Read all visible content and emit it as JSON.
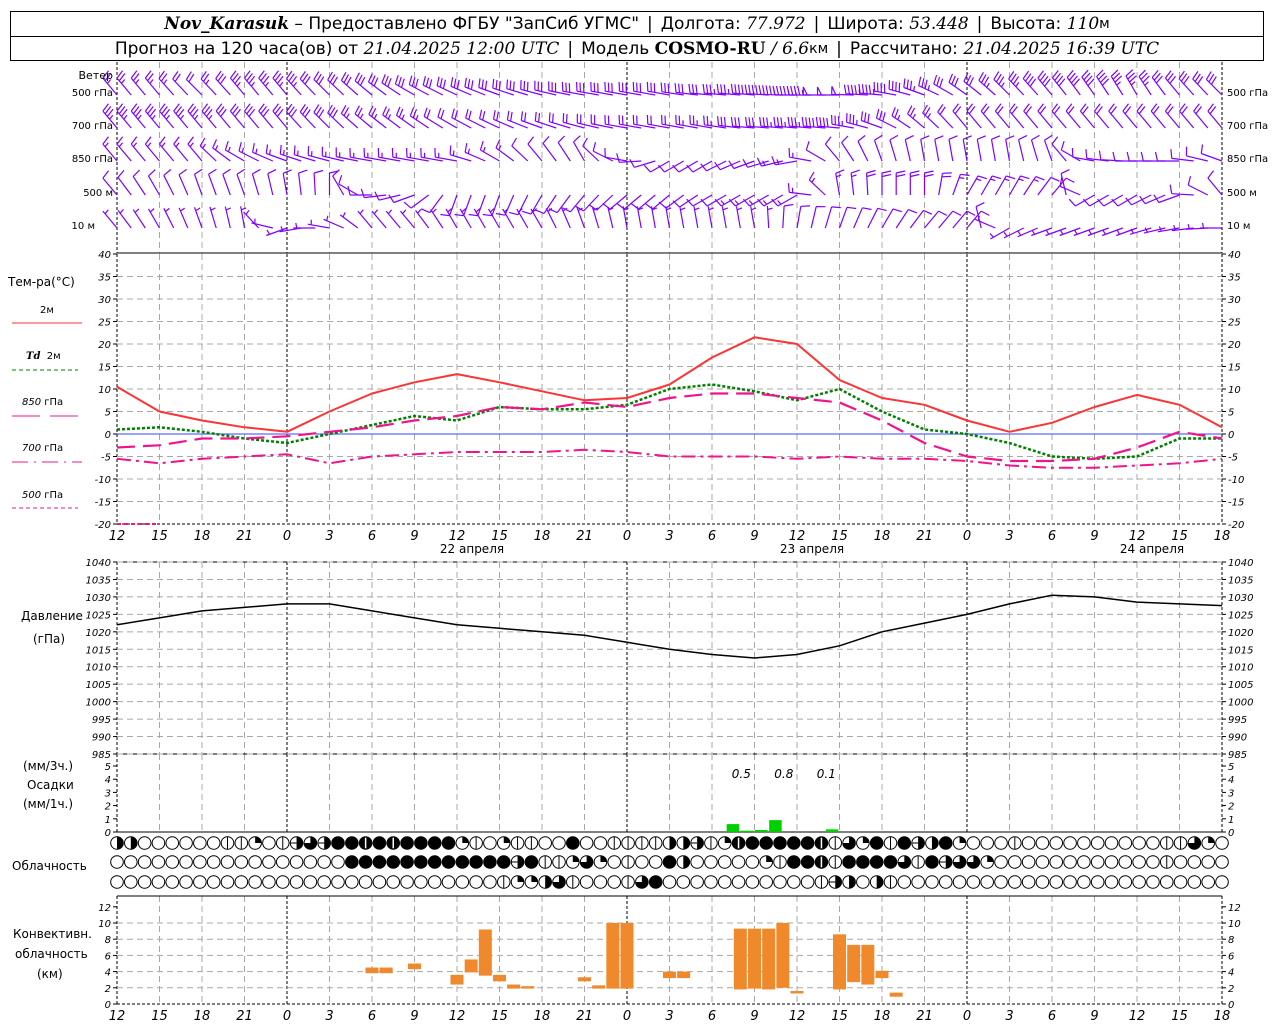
{
  "header": {
    "station": "Nov_Karasuk",
    "provider": "– Предоставлено ФГБУ \"ЗапСиб УГМС\"",
    "lon_label": "Долгота:",
    "lon": "77.972",
    "lat_label": "Широта:",
    "lat": "53.448",
    "alt_label": "Высота:",
    "alt": "110",
    "alt_unit": "м",
    "forecast_label": "Прогноз на 120 часа(ов) от",
    "forecast_time": "21.04.2025 12:00 UTC",
    "model_label": "Модель",
    "model": "COSMO-RU",
    "resolution": "/ 6.6",
    "resolution_unit": "км",
    "calc_label": "Рассчитано:",
    "calc_time": "21.04.2025 16:39 UTC"
  },
  "labels": {
    "wind": "Ветер",
    "lev500hpa": "500 гПа",
    "lev700hpa": "700 гПа",
    "lev850hpa": "850 гПа",
    "lev500m": "500 м",
    "lev10m": "10  м",
    "temp_title": "Тем-ра(°С)",
    "t2m": "2м",
    "td": "Td",
    "td2m": "2м",
    "t850": "850",
    "t700": "700",
    "t500": "500",
    "hpa": "гПа",
    "pressure": "Давление",
    "pressure_unit": "(гПа)",
    "precip_3h": "(мм/3ч.)",
    "precip": "Осадки",
    "precip_1h": "(мм/1ч.)",
    "cloudiness": "Облачность",
    "conv1": "Конвективн.",
    "conv2": "облачность",
    "conv3": "(км)"
  },
  "colors": {
    "wind": "#8000ff",
    "t2m": "#ff3333",
    "td2m": "#008000",
    "upper": "#f0148c",
    "zero_line": "#3344ff",
    "precip": "#00d000",
    "convective": "#f0882c",
    "grid": "#a8a8a8"
  },
  "x_ticks": [
    "12",
    "15",
    "18",
    "21",
    "0",
    "3",
    "6",
    "9",
    "12",
    "15",
    "18",
    "21",
    "0",
    "3",
    "6",
    "9",
    "12",
    "15",
    "18",
    "21",
    "0",
    "3",
    "6",
    "9",
    "12",
    "15",
    "18"
  ],
  "dates": [
    "22 апреля",
    "23 апреля",
    "24 апреля"
  ],
  "chart_data": [
    {
      "type": "barbs",
      "title": "Ветер",
      "levels": [
        {
          "name": "500 гПа",
          "dir": [
            320,
            320,
            315,
            320,
            320,
            315,
            310,
            300,
            295,
            290,
            285,
            280,
            280,
            280,
            275,
            275,
            270,
            270,
            275,
            290,
            305,
            315,
            320,
            325,
            330,
            320,
            315
          ],
          "speed": [
            25,
            25,
            20,
            35,
            35,
            30,
            30,
            30,
            30,
            30,
            30,
            30,
            30,
            30,
            30,
            40,
            45,
            50,
            45,
            35,
            30,
            35,
            40,
            40,
            35,
            30,
            30
          ]
        },
        {
          "name": "700 гПа",
          "dir": [
            320,
            320,
            320,
            320,
            320,
            315,
            310,
            305,
            300,
            295,
            290,
            285,
            280,
            280,
            280,
            275,
            275,
            275,
            290,
            310,
            320,
            320,
            320,
            320,
            320,
            320,
            320
          ],
          "speed": [
            35,
            35,
            35,
            30,
            30,
            30,
            25,
            25,
            20,
            20,
            20,
            20,
            20,
            20,
            25,
            30,
            35,
            40,
            30,
            25,
            20,
            20,
            20,
            20,
            20,
            20,
            20
          ]
        },
        {
          "name": "850 гПа",
          "dir": [
            320,
            320,
            320,
            300,
            290,
            285,
            280,
            280,
            280,
            300,
            320,
            330,
            280,
            240,
            240,
            250,
            260,
            320,
            340,
            350,
            350,
            350,
            340,
            280,
            270,
            270,
            290
          ],
          "speed": [
            15,
            15,
            15,
            15,
            15,
            15,
            15,
            15,
            15,
            15,
            10,
            10,
            10,
            10,
            10,
            10,
            15,
            10,
            10,
            10,
            10,
            10,
            10,
            10,
            10,
            10,
            10
          ]
        },
        {
          "name": "500 м",
          "dir": [
            320,
            330,
            340,
            340,
            350,
            360,
            270,
            250,
            200,
            200,
            210,
            220,
            230,
            230,
            240,
            240,
            240,
            350,
            360,
            360,
            30,
            30,
            40,
            240,
            240,
            250,
            320
          ],
          "speed": [
            10,
            10,
            10,
            10,
            10,
            10,
            10,
            10,
            10,
            10,
            10,
            10,
            10,
            10,
            10,
            15,
            15,
            15,
            20,
            20,
            15,
            15,
            10,
            10,
            10,
            10,
            10
          ]
        },
        {
          "name": "10 м",
          "dir": [
            320,
            330,
            340,
            350,
            250,
            280,
            320,
            320,
            330,
            330,
            330,
            340,
            350,
            350,
            350,
            350,
            10,
            20,
            30,
            40,
            40,
            240,
            250,
            250,
            250,
            260,
            270
          ],
          "speed": [
            5,
            5,
            5,
            5,
            5,
            5,
            5,
            5,
            5,
            5,
            5,
            5,
            5,
            5,
            5,
            5,
            10,
            10,
            10,
            10,
            10,
            5,
            5,
            5,
            5,
            5,
            5
          ]
        }
      ]
    },
    {
      "type": "line",
      "ylabel": "Тем-ра(°С)",
      "ylim": [
        -20,
        40
      ],
      "yticks": [
        40,
        35,
        30,
        25,
        20,
        15,
        10,
        5,
        0,
        -5,
        -10,
        -15,
        -20
      ],
      "grid": true,
      "series": [
        {
          "name": "2м",
          "style": "solid",
          "values": [
            10.5,
            5,
            3,
            1.5,
            0.5,
            5,
            9,
            11.5,
            13.3,
            11.5,
            9.5,
            7.5,
            8,
            11,
            17,
            21.5,
            20,
            12,
            8,
            6.5,
            3,
            0.5,
            2.5,
            6,
            8.7,
            6.5,
            1.5
          ]
        },
        {
          "name": "Td 2м",
          "style": "dotted",
          "values": [
            1,
            1.5,
            0.5,
            -1,
            -2,
            0,
            2,
            4,
            3,
            6,
            5.5,
            5.5,
            6.5,
            10,
            11,
            9.5,
            7.5,
            10,
            5,
            1,
            0,
            -2,
            -5,
            -5.5,
            -5,
            -1,
            -1
          ]
        },
        {
          "name": "850 гПа",
          "style": "long-dash",
          "values": [
            -3,
            -2.5,
            -1,
            -1,
            -0.5,
            0.5,
            1.5,
            3,
            4,
            6,
            5.5,
            7,
            6,
            8,
            9,
            9,
            8,
            7,
            3,
            -2,
            -5,
            -6,
            -6,
            -5.5,
            -3,
            0.5,
            -1
          ]
        },
        {
          "name": "700 гПа",
          "style": "dash-dot",
          "values": [
            -5.5,
            -6.5,
            -5.5,
            -5,
            -4.5,
            -6.5,
            -5,
            -4.5,
            -4,
            -4,
            -4,
            -3.5,
            -4,
            -5,
            -5,
            -5,
            -5.5,
            -5,
            -5.5,
            -5.5,
            -6,
            -7,
            -7.5,
            -7.5,
            -7,
            -6.5,
            -5.5
          ]
        },
        {
          "name": "500 гПа",
          "style": "dashed",
          "values": [
            -20,
            -20,
            null,
            null,
            null,
            null,
            null,
            null,
            null,
            null,
            null,
            null,
            null,
            null,
            null,
            null,
            null,
            null,
            null,
            null,
            null,
            null,
            null,
            null,
            null,
            null,
            null
          ]
        }
      ]
    },
    {
      "type": "line",
      "ylabel": "Давление (гПа)",
      "ylim": [
        985,
        1040
      ],
      "yticks": [
        1040,
        1035,
        1030,
        1025,
        1020,
        1015,
        1010,
        1005,
        1000,
        995,
        990,
        985
      ],
      "grid": true,
      "values": [
        1022,
        1024,
        1026,
        1027,
        1028,
        1028,
        1026,
        1024,
        1022,
        1021,
        1020,
        1019,
        1017,
        1015,
        1013.5,
        1012.5,
        1013.5,
        1016,
        1020,
        1022.5,
        1025,
        1028,
        1030.5,
        1030,
        1028.5,
        1028,
        1027.5
      ]
    },
    {
      "type": "bar",
      "ylabel": "Осадки",
      "ylim": [
        0,
        5
      ],
      "yticks": [
        5,
        4,
        3,
        2,
        1,
        0
      ],
      "hourly_mm": [
        0,
        0,
        0,
        0,
        0,
        0,
        0,
        0,
        0,
        0,
        0,
        0,
        0,
        0,
        0,
        0,
        0,
        0,
        0,
        0,
        0,
        0,
        0,
        0,
        0,
        0,
        0,
        0,
        0,
        0,
        0,
        0,
        0,
        0,
        0,
        0,
        0,
        0,
        0,
        0,
        0,
        0,
        0,
        0.6,
        0.1,
        0.15,
        0.9,
        0,
        0,
        0,
        0.2,
        0,
        0,
        0,
        0,
        0,
        0,
        0,
        0,
        0,
        0,
        0,
        0,
        0,
        0,
        0,
        0,
        0,
        0,
        0,
        0,
        0,
        0,
        0,
        0,
        0,
        0,
        0,
        0
      ],
      "sums_3h": [
        {
          "value": "0.5",
          "at_hour_index": 44
        },
        {
          "value": "0.8",
          "at_hour_index": 47
        },
        {
          "value": "0.1",
          "at_hour_index": 50
        }
      ]
    },
    {
      "type": "table",
      "title": "Облачность",
      "scale": "octas",
      "rows": [
        [
          4,
          4,
          0,
          0,
          0,
          0,
          0,
          0,
          1,
          1,
          2,
          0,
          1,
          5,
          6,
          5,
          8,
          8,
          7,
          8,
          7,
          8,
          8,
          8,
          8,
          2,
          1,
          0,
          2,
          1,
          1,
          0,
          0,
          8,
          0,
          0,
          1,
          1,
          1,
          1,
          4,
          4,
          5,
          1,
          2,
          7,
          8,
          8,
          8,
          8,
          8,
          7,
          1,
          6,
          2,
          8,
          1,
          8,
          5,
          4,
          8,
          2,
          0,
          0,
          0,
          1,
          0,
          0,
          0,
          0,
          0,
          0,
          0,
          0,
          0,
          0,
          1,
          1,
          6,
          2,
          0
        ],
        [
          0,
          0,
          0,
          0,
          0,
          0,
          0,
          0,
          0,
          0,
          0,
          0,
          0,
          0,
          0,
          0,
          0,
          8,
          8,
          8,
          8,
          8,
          8,
          8,
          8,
          8,
          8,
          8,
          8,
          5,
          8,
          1,
          1,
          2,
          6,
          2,
          0,
          1,
          0,
          0,
          8,
          4,
          0,
          0,
          0,
          0,
          0,
          2,
          1,
          8,
          8,
          7,
          1,
          8,
          8,
          8,
          8,
          6,
          1,
          8,
          5,
          6,
          6,
          2,
          0,
          0,
          0,
          0,
          0,
          0,
          0,
          0,
          0,
          0,
          0,
          0,
          1,
          0,
          0,
          0,
          0
        ],
        [
          0,
          0,
          0,
          0,
          0,
          0,
          0,
          0,
          0,
          0,
          0,
          0,
          0,
          0,
          0,
          0,
          0,
          0,
          0,
          0,
          0,
          0,
          0,
          0,
          0,
          0,
          0,
          0,
          1,
          2,
          2,
          4,
          6,
          1,
          0,
          0,
          0,
          1,
          6,
          8,
          0,
          0,
          0,
          0,
          0,
          0,
          0,
          0,
          0,
          0,
          0,
          1,
          5,
          4,
          0,
          4,
          1,
          0,
          0,
          0,
          0,
          0,
          0,
          0,
          0,
          0,
          0,
          0,
          0,
          0,
          0,
          0,
          0,
          0,
          0,
          0,
          0,
          0,
          0,
          0,
          0
        ]
      ]
    },
    {
      "type": "bar",
      "ylabel": "Конвективн. облачность (км)",
      "ylim": [
        0,
        13
      ],
      "yticks": [
        12,
        10,
        8,
        6,
        4,
        2,
        0
      ],
      "hourly_base_top_km": [
        null,
        null,
        null,
        null,
        null,
        null,
        null,
        null,
        null,
        null,
        null,
        null,
        null,
        null,
        null,
        null,
        null,
        null,
        [
          3.8,
          4.5
        ],
        [
          3.8,
          4.5
        ],
        null,
        [
          4.3,
          5
        ],
        null,
        null,
        [
          2.4,
          3.6
        ],
        [
          3.9,
          5.5
        ],
        [
          3.5,
          9.2
        ],
        [
          2.8,
          3.6
        ],
        [
          1.9,
          2.4
        ],
        [
          1.9,
          2.2
        ],
        null,
        null,
        null,
        [
          2.8,
          3.3
        ],
        [
          1.9,
          2.3
        ],
        [
          1.9,
          10
        ],
        [
          1.9,
          10
        ],
        null,
        null,
        [
          3.2,
          4
        ],
        [
          3.2,
          4
        ],
        null,
        null,
        null,
        [
          1.8,
          9.3
        ],
        [
          1.9,
          9.3
        ],
        [
          1.8,
          9.3
        ],
        [
          2,
          10
        ],
        [
          1.3,
          1.6
        ],
        null,
        null,
        [
          1.8,
          8.6
        ],
        [
          2.7,
          7.3
        ],
        [
          2.4,
          7.3
        ],
        [
          3.2,
          4.1
        ],
        [
          0.9,
          1.4
        ],
        null,
        null,
        null,
        null,
        null,
        null,
        null,
        null,
        null,
        null,
        null,
        null,
        null,
        null,
        null,
        null,
        null,
        null,
        null,
        null,
        null,
        null,
        null
      ]
    }
  ]
}
